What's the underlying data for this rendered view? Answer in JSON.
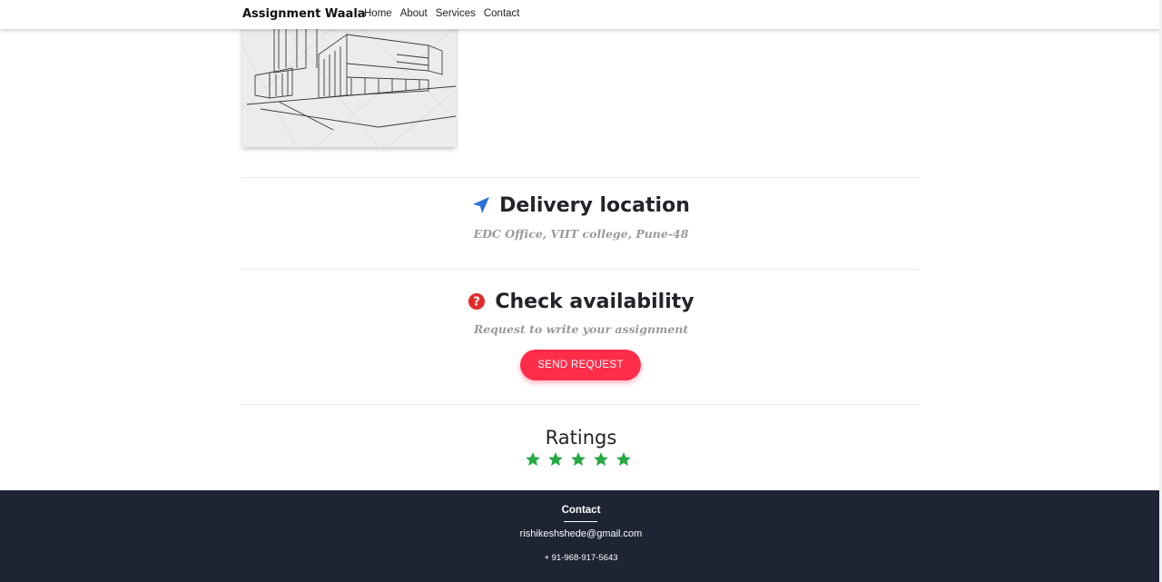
{
  "navbar": {
    "brand": "Assignment Waala",
    "links": [
      "Home",
      "About",
      "Services",
      "Contact"
    ]
  },
  "delivery": {
    "title": "Delivery location",
    "address": "EDC Office, VIIT college, Pune-48",
    "icon": "location-arrow-icon",
    "icon_color": "#2a6fdb"
  },
  "availability": {
    "title": "Check availability",
    "subtitle": "Request to write your assignment",
    "button_label": "SEND REQUEST",
    "icon": "question-circle-icon",
    "icon_color": "#e02b2b",
    "button_color": "#ff2d4a"
  },
  "ratings": {
    "title": "Ratings",
    "stars": 5,
    "max_stars": 5,
    "star_color": "#27a844"
  },
  "footer": {
    "heading": "Contact",
    "email": "rishikeshshede@gmail.com",
    "phone": "+ 91-968-917-5643",
    "background": "#1e2433"
  }
}
